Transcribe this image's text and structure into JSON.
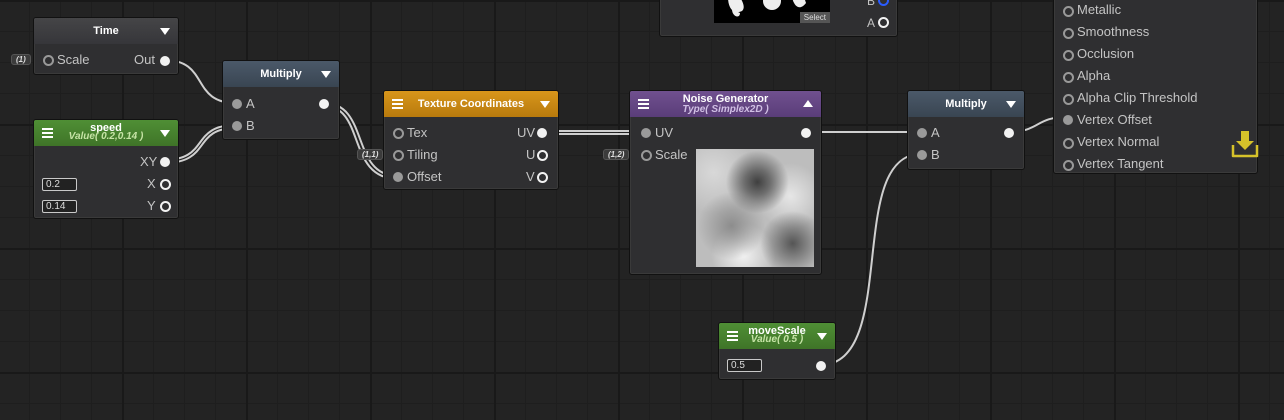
{
  "colors": {
    "grid_bg": "#232323",
    "wire": "#cfcfcf",
    "header_green": "#4f8f35",
    "header_orange": "#d8961b",
    "header_purple": "#70508f",
    "header_blue": "#4b5969",
    "save_icon": "#d6c22a"
  },
  "time_node": {
    "title": "Time",
    "in_scale": "Scale",
    "out": "Out",
    "scale_tag": "(1)"
  },
  "speed_node": {
    "title": "speed",
    "subtitle": "Value( 0.2,0.14 )",
    "out_xy": "XY",
    "out_x": "X",
    "out_y": "Y",
    "x_value": "0.2",
    "y_value": "0.14"
  },
  "multiply1": {
    "title": "Multiply",
    "in_a": "A",
    "in_b": "B"
  },
  "texcoord": {
    "title": "Texture Coordinates",
    "in_tex": "Tex",
    "in_tiling": "Tiling",
    "in_offset": "Offset",
    "out_uv": "UV",
    "out_u": "U",
    "out_v": "V",
    "tiling_tag": "(1,1)"
  },
  "noise": {
    "title": "Noise Generator",
    "subtitle": "Type( Simplex2D )",
    "in_uv": "UV",
    "in_scale": "Scale",
    "scale_tag": "(1,2)"
  },
  "texture_node": {
    "select_label": "Select",
    "out_b": "B",
    "out_a": "A"
  },
  "multiply2": {
    "title": "Multiply",
    "in_a": "A",
    "in_b": "B"
  },
  "movescale": {
    "title": "moveScale",
    "subtitle": "Value( 0.5 )",
    "value": "0.5"
  },
  "master": {
    "inputs": [
      "Metallic",
      "Smoothness",
      "Occlusion",
      "Alpha",
      "Alpha Clip Threshold",
      "Vertex Offset",
      "Vertex Normal",
      "Vertex Tangent"
    ],
    "save_icon": "save-download-icon"
  }
}
